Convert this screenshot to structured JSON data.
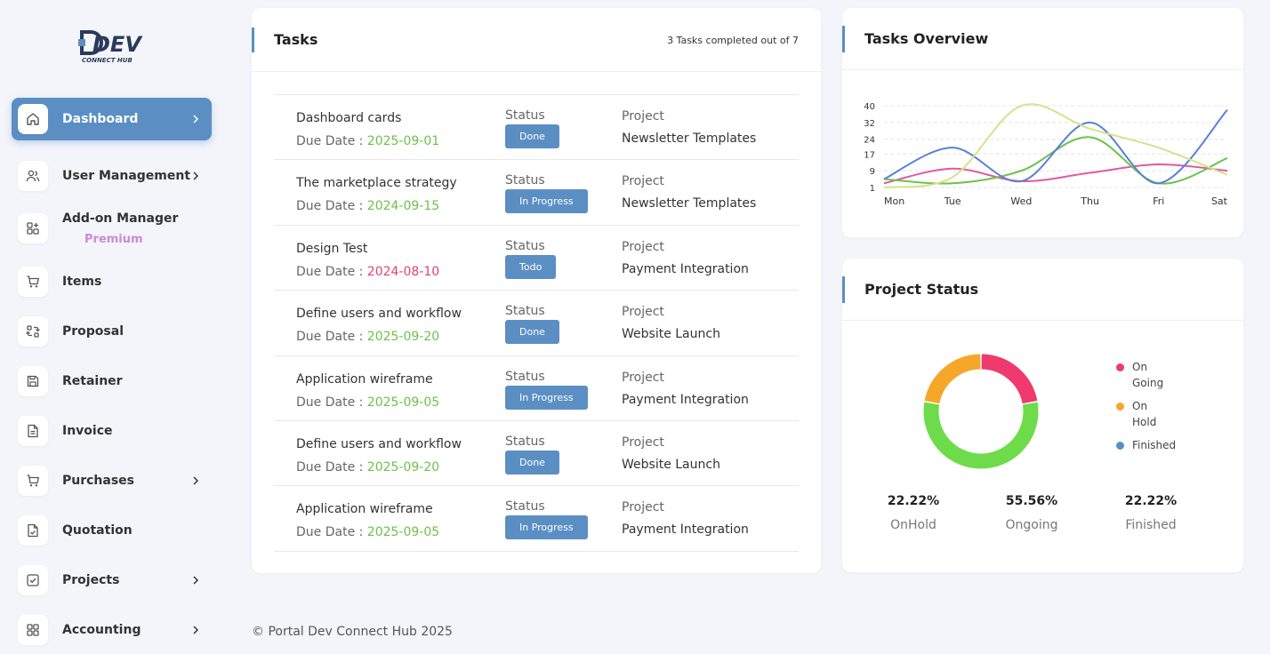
{
  "brand": {
    "logo_text": "DEV",
    "logo_sub": "CONNECT HUB"
  },
  "sidebar": {
    "items": [
      {
        "label": "Dashboard",
        "icon": "home-icon",
        "active": true,
        "chevron": true
      },
      {
        "label": "User Management",
        "icon": "users-icon",
        "chevron": true
      },
      {
        "label": "Add-on Manager",
        "sub": "Premium",
        "icon": "apps-add-icon",
        "chevron": false
      },
      {
        "label": "Items",
        "icon": "cart-icon",
        "chevron": false
      },
      {
        "label": "Proposal",
        "icon": "exchange-icon",
        "chevron": false
      },
      {
        "label": "Retainer",
        "icon": "save-icon",
        "chevron": false
      },
      {
        "label": "Invoice",
        "icon": "document-icon",
        "chevron": false
      },
      {
        "label": "Purchases",
        "icon": "cart-icon",
        "chevron": true
      },
      {
        "label": "Quotation",
        "icon": "file-check-icon",
        "chevron": false
      },
      {
        "label": "Projects",
        "icon": "checkbox-icon",
        "chevron": true
      },
      {
        "label": "Accounting",
        "icon": "grid-icon",
        "chevron": true
      }
    ]
  },
  "tasks": {
    "title": "Tasks",
    "summary": "3 Tasks completed out of 7",
    "status_label": "Status",
    "project_label": "Project",
    "due_label": "Due Date : ",
    "rows": [
      {
        "name": "Dashboard cards",
        "due": "2025-09-01",
        "overdue": false,
        "status": "Done",
        "project": "Newsletter Templates"
      },
      {
        "name": "The marketplace strategy",
        "due": "2024-09-15",
        "overdue": false,
        "status": "In Progress",
        "project": "Newsletter Templates"
      },
      {
        "name": "Design Test",
        "due": "2024-08-10",
        "overdue": true,
        "status": "Todo",
        "project": "Payment Integration"
      },
      {
        "name": "Define users and workflow",
        "due": "2025-09-20",
        "overdue": false,
        "status": "Done",
        "project": "Website Launch"
      },
      {
        "name": "Application wireframe",
        "due": "2025-09-05",
        "overdue": false,
        "status": "In Progress",
        "project": "Payment Integration"
      },
      {
        "name": "Define users and workflow",
        "due": "2025-09-20",
        "overdue": false,
        "status": "Done",
        "project": "Website Launch"
      },
      {
        "name": "Application wireframe",
        "due": "2025-09-05",
        "overdue": false,
        "status": "In Progress",
        "project": "Payment Integration"
      }
    ]
  },
  "overview": {
    "title": "Tasks Overview",
    "chart_data": {
      "type": "line",
      "categories": [
        "Mon",
        "Tue",
        "Wed",
        "Thu",
        "Fri",
        "Sat"
      ],
      "y_ticks": [
        1,
        9,
        17,
        24,
        32,
        40
      ],
      "ylim": [
        1,
        40
      ],
      "grid": true,
      "smooth": true,
      "series": [
        {
          "color": "#e05aa0",
          "values": [
            3,
            10,
            4,
            8,
            12,
            9
          ]
        },
        {
          "color": "#6cc24a",
          "values": [
            5,
            3,
            9,
            25,
            3,
            15
          ]
        },
        {
          "color": "#5b7fd8",
          "values": [
            5,
            20,
            4,
            32,
            3,
            38
          ]
        },
        {
          "color": "#d4e38a",
          "values": [
            1,
            6,
            40,
            29,
            20,
            7
          ]
        }
      ]
    }
  },
  "project_status": {
    "title": "Project Status",
    "chart_data": {
      "type": "pie",
      "donut": true,
      "slices": [
        {
          "label": "On Going",
          "value": 22.22,
          "color": "#f0396e"
        },
        {
          "label": "Finished",
          "value": 55.56,
          "color": "#6edc4a"
        },
        {
          "label": "On Hold",
          "value": 22.22,
          "color": "#f6a72a"
        }
      ]
    },
    "legend": [
      {
        "label": "On Going",
        "color": "#f0396e"
      },
      {
        "label": "On Hold",
        "color": "#f6a72a"
      },
      {
        "label": "Finished",
        "color": "#5b8fc4"
      }
    ],
    "stats": [
      {
        "value": "22.22%",
        "label": "OnHold"
      },
      {
        "value": "55.56%",
        "label": "Ongoing"
      },
      {
        "value": "22.22%",
        "label": "Finished"
      }
    ]
  },
  "footer": "© Portal Dev Connect Hub 2025"
}
